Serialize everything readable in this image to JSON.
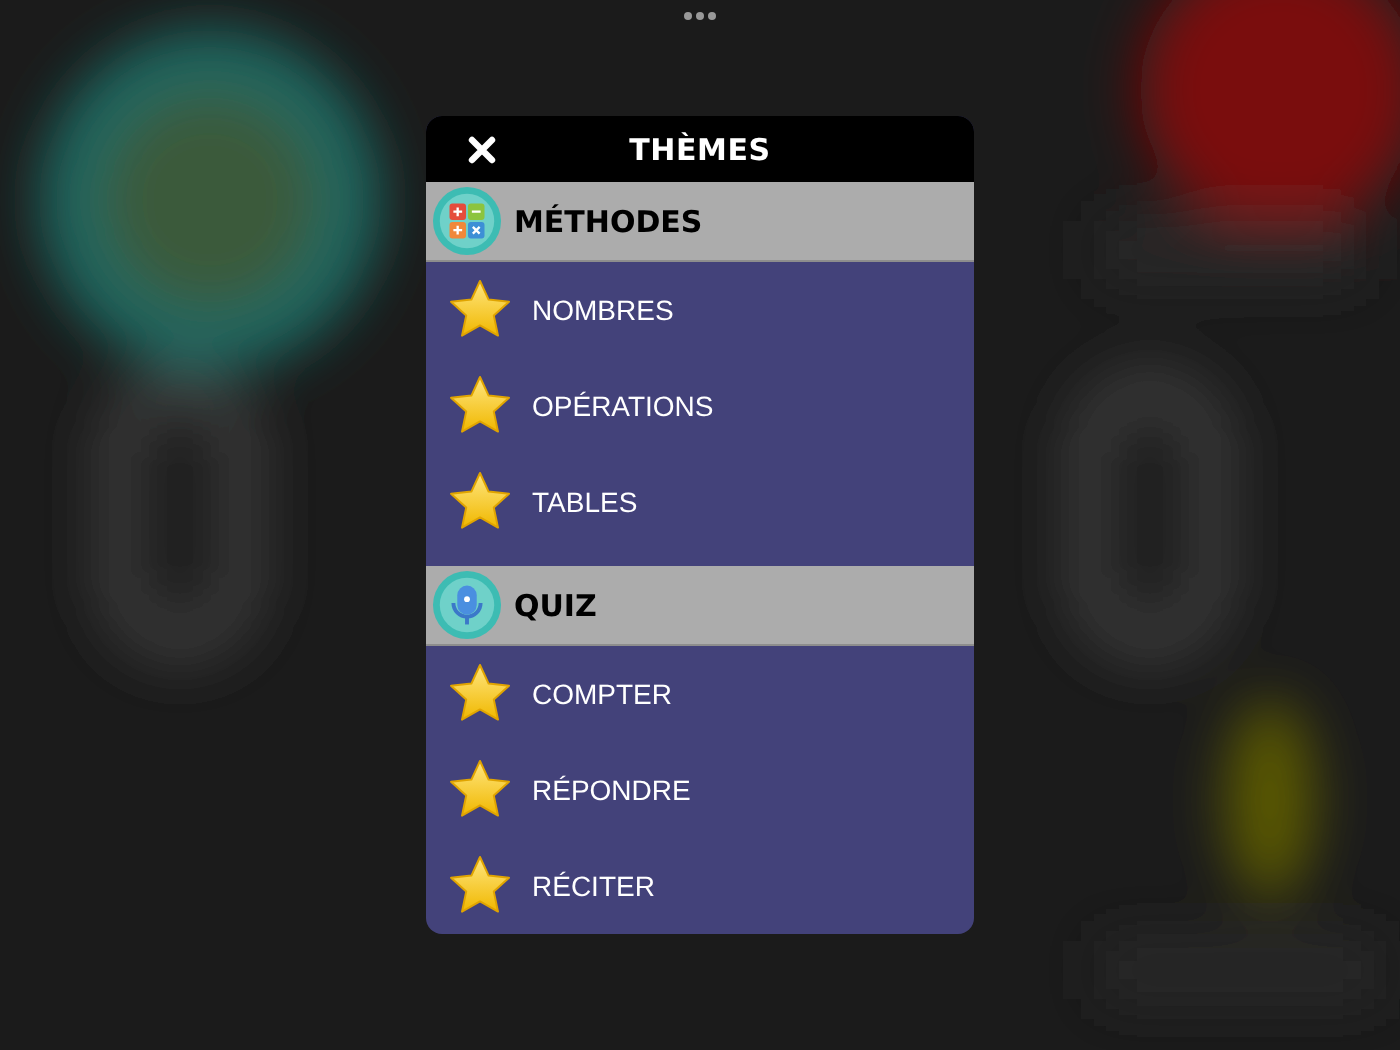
{
  "dialog": {
    "title": "THÈMES"
  },
  "sections": [
    {
      "kind": "calculator",
      "title": "MÉTHODES",
      "items": [
        {
          "label": "NOMBRES"
        },
        {
          "label": "OPÉRATIONS"
        },
        {
          "label": "TABLES"
        }
      ]
    },
    {
      "kind": "microphone",
      "title": "QUIZ",
      "items": [
        {
          "label": "COMPTER"
        },
        {
          "label": "RÉPONDRE"
        },
        {
          "label": "RÉCITER"
        }
      ]
    }
  ]
}
